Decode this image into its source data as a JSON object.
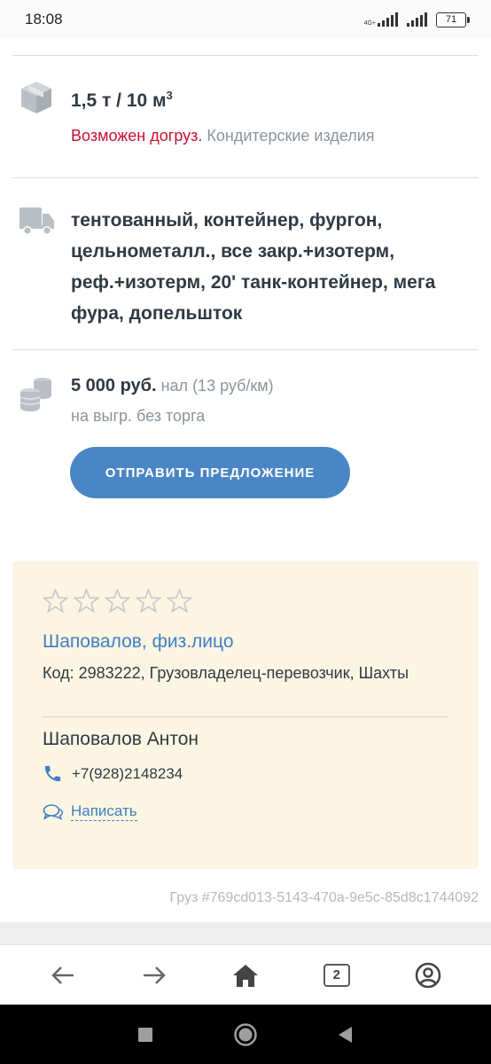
{
  "status_bar": {
    "time": "18:08",
    "network_label": "4G+",
    "battery": "71"
  },
  "load": {
    "weight_volume": "1,5 т / 10 м",
    "volume_exp": "3",
    "extra_load_note": "Возможен догруз.",
    "cargo_type": "Кондитерские изделия",
    "icon": "box-icon"
  },
  "truck": {
    "types": "тентованный, контейнер, фургон, цельнометалл., все закр.+изотерм, реф.+изотерм, 20' танк-контейнер, мега фура, допельшток",
    "icon": "truck-icon"
  },
  "payment": {
    "price": "5 000 руб.",
    "method": "нал (13 руб/км)",
    "terms": "на выгр. без торга",
    "icon": "coins-icon"
  },
  "offer_button_label": "ОТПРАВИТЬ ПРЕДЛОЖЕНИЕ",
  "owner_card": {
    "rating_stars": 0,
    "rating_max": 5,
    "name": "Шаповалов, физ.лицо",
    "code_line": "Код: 2983222, Грузовладелец-перевозчик, Шахты",
    "contact_name": "Шаповалов Антон",
    "phone": "+7(928)2148234",
    "write_label": "Написать"
  },
  "cargo_id": "Груз #769cd013-5143-470a-9e5c-85d8c1744092",
  "browser_nav": {
    "tab_count": "2"
  },
  "colors": {
    "accent_blue": "#4a86c5",
    "link_blue": "#3d7fc4",
    "warning_red": "#c8102e",
    "card_bg": "#fdf5e3"
  }
}
